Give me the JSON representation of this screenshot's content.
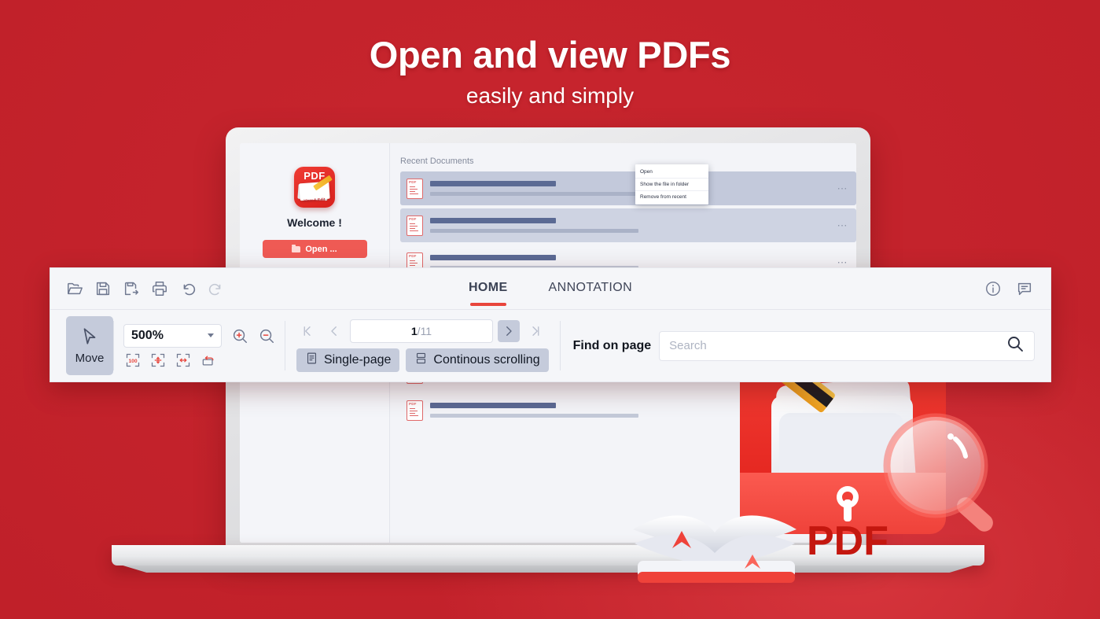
{
  "headline": {
    "title": "Open and view PDFs",
    "subtitle": "easily and simply"
  },
  "colors": {
    "background_red": "#c8252e",
    "accent_red": "#e8453c",
    "button_red": "#ef5a54",
    "toolbar_bg": "#f5f6f9",
    "chip_bg": "#c5cbdb",
    "text_dark": "#11161f"
  },
  "app": {
    "welcome_panel": {
      "app_icon_label": "PDF",
      "app_icon_sublabel": "View & Edit",
      "welcome_text": "Welcome !",
      "open_button": "Open ..."
    },
    "recent": {
      "title": "Recent Documents",
      "row_overflow_label": "⋯",
      "rows": [
        {
          "state": "selected"
        },
        {
          "state": "selected"
        },
        {
          "state": "plain"
        },
        {
          "state": "plain"
        },
        {
          "state": "plain"
        },
        {
          "state": "plain"
        },
        {
          "state": "plain"
        }
      ]
    },
    "context_menu": {
      "items": [
        "Open",
        "Show the file in folder",
        "Remove from recent"
      ]
    }
  },
  "toolbar": {
    "file_icons": [
      {
        "name": "open-folder-icon",
        "title": "Open"
      },
      {
        "name": "save-icon",
        "title": "Save"
      },
      {
        "name": "save-as-icon",
        "title": "Save as"
      },
      {
        "name": "print-icon",
        "title": "Print"
      },
      {
        "name": "undo-icon",
        "title": "Undo"
      },
      {
        "name": "redo-icon",
        "title": "Redo",
        "disabled": true
      }
    ],
    "tabs": [
      {
        "label": "HOME",
        "active": true
      },
      {
        "label": "ANNOTATION",
        "active": false
      }
    ],
    "right_icons": [
      {
        "name": "info-icon"
      },
      {
        "name": "comment-icon"
      }
    ],
    "move_tool": {
      "label": "Move",
      "active": true
    },
    "zoom": {
      "value": "500%",
      "zoom_in_title": "Zoom in",
      "zoom_out_title": "Zoom out",
      "fit_actual_size": "100",
      "fit_page_title": "Fit page",
      "fit_width_title": "Fit width",
      "rotate_title": "Rotate"
    },
    "pagination": {
      "current_page": "1",
      "separator": "/",
      "total_pages": "11",
      "first_title": "First page",
      "prev_title": "Previous page",
      "next_title": "Next page",
      "last_title": "Last page"
    },
    "view_modes": [
      {
        "label": "Single-page",
        "active": true
      },
      {
        "label": "Continous scrolling",
        "active": true
      }
    ],
    "find": {
      "label": "Find on page",
      "placeholder": "Search",
      "value": ""
    }
  },
  "illustration": {
    "pdf_label": "PDF",
    "elements": [
      "folder",
      "documents",
      "pencil",
      "open-book",
      "magnifier"
    ]
  }
}
